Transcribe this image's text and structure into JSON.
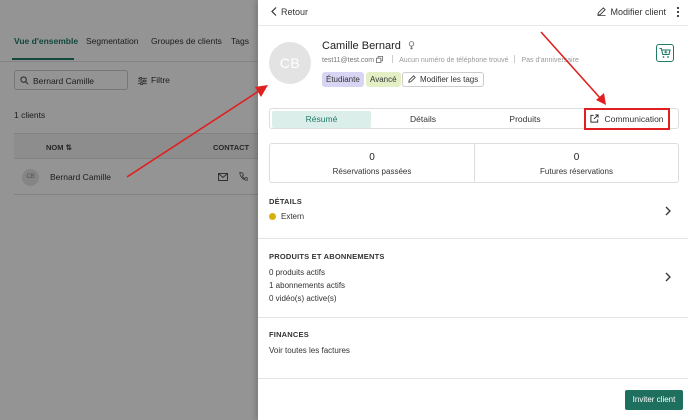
{
  "background": {
    "tabs": [
      "Vue d'ensemble",
      "Segmentation",
      "Groupes de clients",
      "Tags"
    ],
    "search_value": "Bernard Camille",
    "filter_label": "Filtre",
    "count_label": "1 clients",
    "table": {
      "headers": [
        "NOM",
        "CONTACT"
      ],
      "rows": [
        {
          "avatar": "CB",
          "name": "Bernard Camille"
        }
      ]
    }
  },
  "drawer": {
    "back_label": "Retour",
    "edit_label": "Modifier client",
    "avatar_initials": "CB",
    "client_name": "Camille Bernard",
    "email": "test11@test.com",
    "phone": "Aucun numéro de téléphone trouvé",
    "birthday": "Pas d'anniversaire",
    "tags": [
      "Étudiante",
      "Avancé"
    ],
    "edit_tags_label": "Modifier les tags",
    "tabs": [
      "Résumé",
      "Détails",
      "Produits",
      "Communication"
    ],
    "active_tab": "Résumé",
    "stats": [
      {
        "value": "0",
        "label": "Réservations passées"
      },
      {
        "value": "0",
        "label": "Futures réservations"
      }
    ],
    "details": {
      "title": "DÉTAILS",
      "status": "Extern"
    },
    "products": {
      "title": "PRODUITS ET ABONNEMENTS",
      "lines": [
        "0 produits actifs",
        "1 abonnements actifs",
        "0 vidéo(s) active(s)"
      ]
    },
    "finances": {
      "title": "FINANCES",
      "link": "Voir toutes les factures"
    },
    "invite_label": "Inviter client"
  },
  "colors": {
    "accent": "#1f7a66",
    "annotation": "#e02020",
    "status_dot": "#d6b00b"
  }
}
